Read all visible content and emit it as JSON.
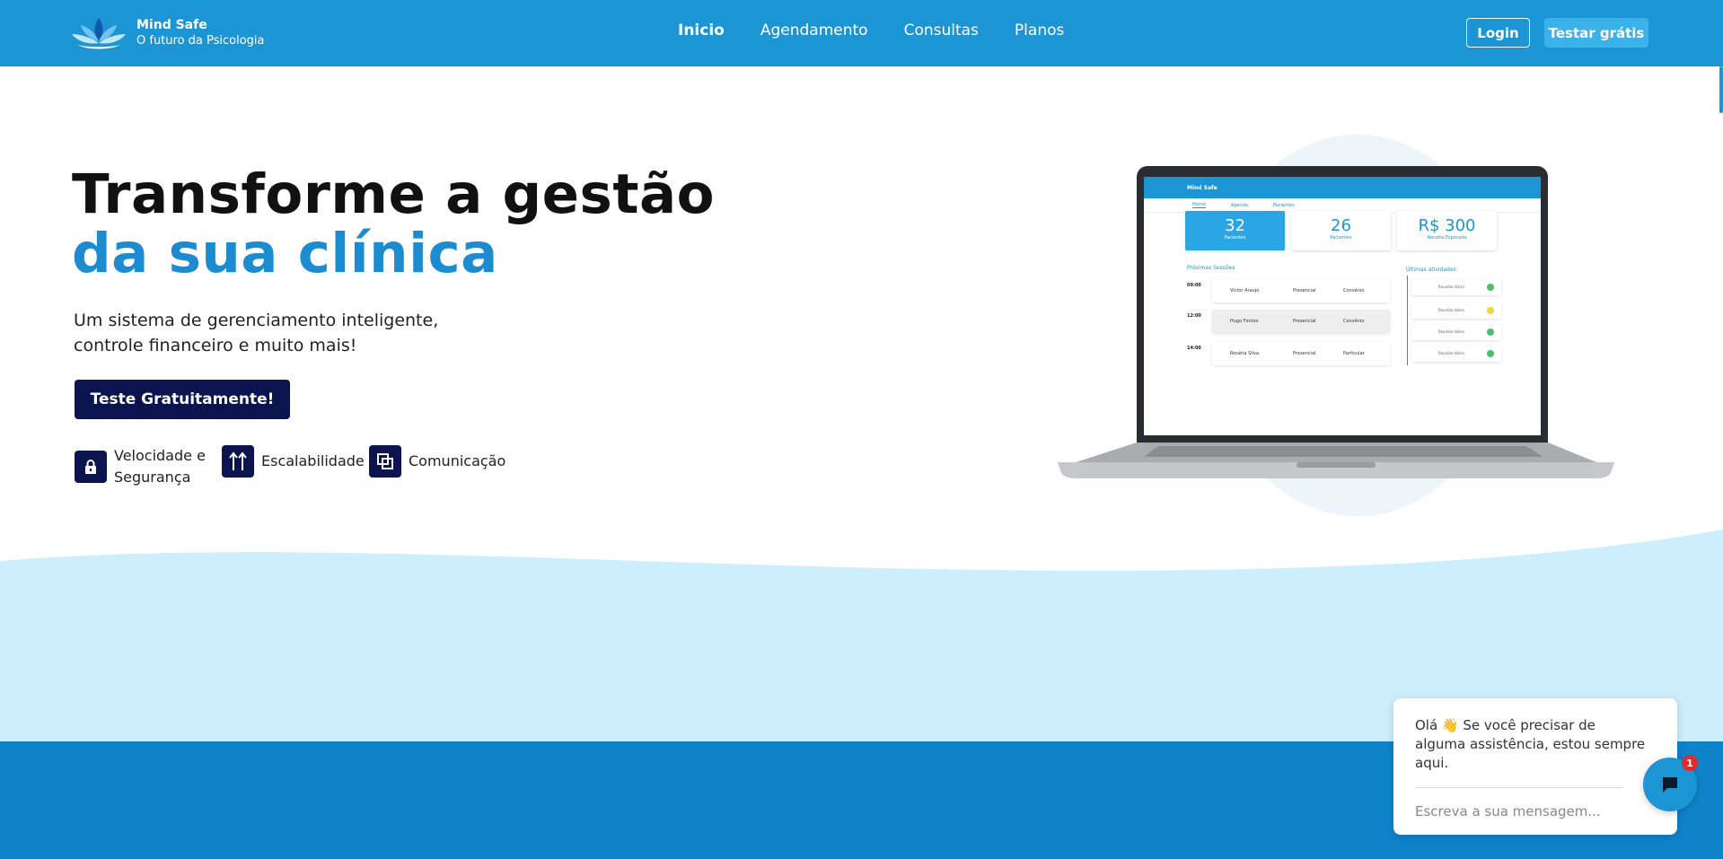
{
  "brand": {
    "name": "Mind Safe",
    "tagline": "O futuro da Psicologia"
  },
  "nav": {
    "items": [
      "Inicio",
      "Agendamento",
      "Consultas",
      "Planos"
    ],
    "active": "Inicio"
  },
  "header_actions": {
    "login": "Login",
    "trial": "Testar grátis"
  },
  "hero": {
    "title_line1": "Transforme a gestão",
    "title_line2": "da sua clínica",
    "subtitle_line1": "Um sistema de gerenciamento inteligente,",
    "subtitle_line2": "controle financeiro e muito mais!",
    "cta": "Teste Gratuitamente!"
  },
  "features": [
    {
      "icon": "lock-icon",
      "label_line1": "Velocidade e",
      "label_line2": "Segurança"
    },
    {
      "icon": "arrows-up-icon",
      "label_line1": "Escalabilidade",
      "label_line2": ""
    },
    {
      "icon": "overlap-squares-icon",
      "label_line1": "Comunicação",
      "label_line2": ""
    }
  ],
  "mockup": {
    "brand": "Mind Safe",
    "tabs": [
      "Home",
      "Agenda",
      "Pacientes"
    ],
    "cards": [
      {
        "value": "32",
        "caption": "Pacientes"
      },
      {
        "value": "26",
        "caption": "Pacientes"
      },
      {
        "value": "R$ 300",
        "caption": "Receita Esperada"
      }
    ],
    "sessions_title": "Próximas Sessões",
    "activity_title": "Últimas atividades",
    "sessions": [
      {
        "time": "09:00",
        "name": "Victor Araujo",
        "mode": "Presencial",
        "payment": "Convênio"
      },
      {
        "time": "12:00",
        "name": "Hugo Fontes",
        "mode": "Presencial",
        "payment": "Convênio"
      },
      {
        "time": "14:00",
        "name": "Rosária Silva",
        "mode": "Presencial",
        "payment": "Particular"
      }
    ],
    "activities": [
      "Reunião diária",
      "Reunião diária",
      "Reunião diária",
      "Reunião diária"
    ]
  },
  "chat": {
    "message": "Olá 👋 Se você precisar de alguma assistência, estou sempre aqui.",
    "placeholder": "Escreva a sua mensagem...",
    "badge": "1"
  },
  "colors": {
    "primary": "#1c95d5",
    "navy": "#0c1450",
    "light_wave": "#cdeefc",
    "footer": "#0f83ca"
  }
}
